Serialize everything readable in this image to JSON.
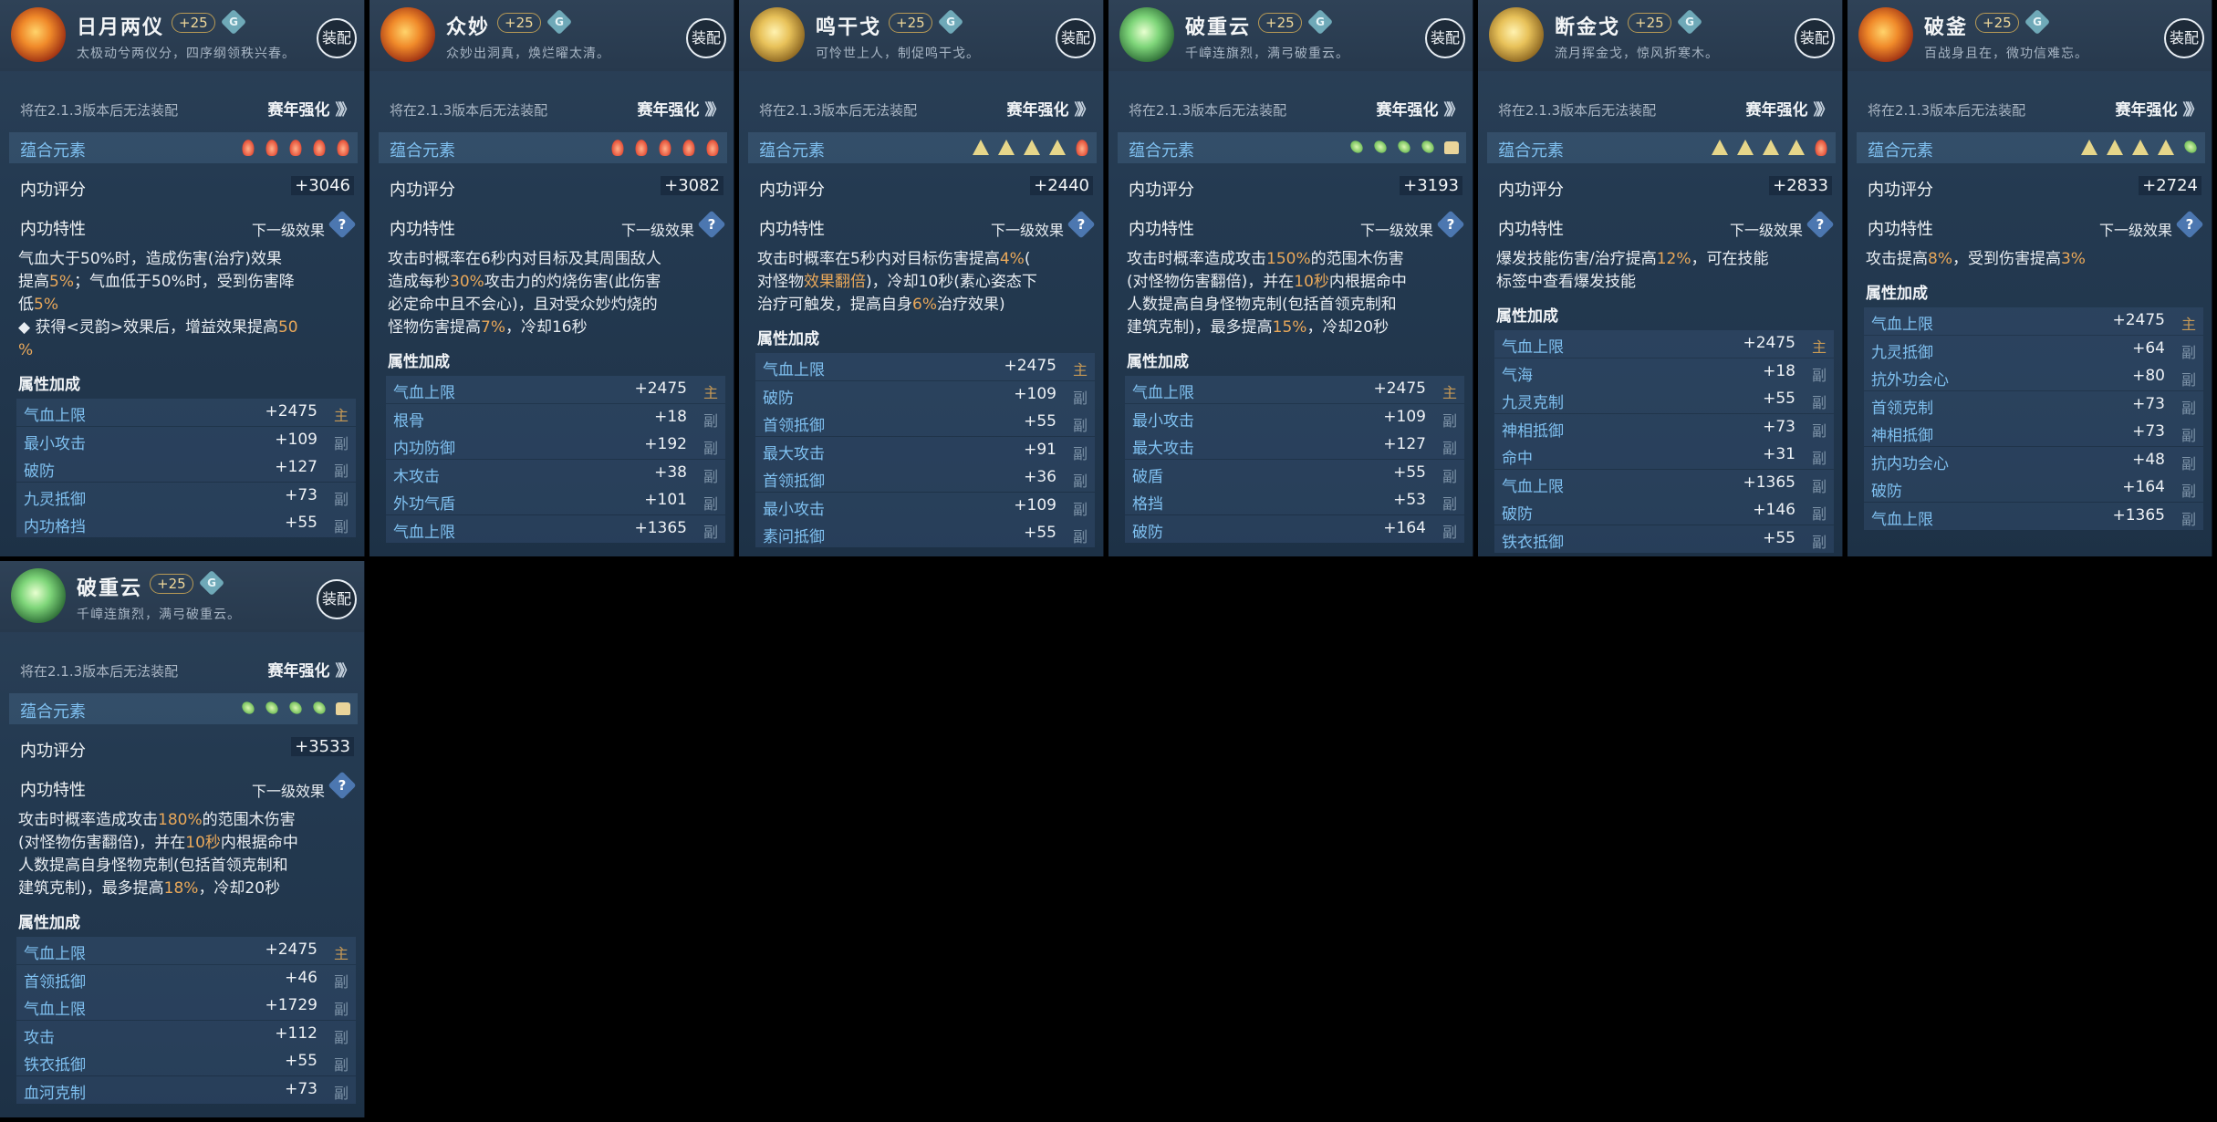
{
  "common": {
    "notice": "将在2.1.3版本后无法装配",
    "season": "赛年强化",
    "season_arrow": "》》",
    "equip": "装配",
    "element_label": "蕴合元素",
    "score_label": "内功评分",
    "trait_label": "内功特性",
    "next_label": "下一级效果",
    "q": "?",
    "attr_label": "属性加成",
    "g_badge": "G"
  },
  "cards": [
    {
      "name": "日月两仪",
      "plus": "+25",
      "emblem": "fire",
      "desc": "太极动兮两仪分，四序纲领秩兴春。",
      "gems": [
        "fire",
        "fire",
        "fire",
        "fire",
        "fire"
      ],
      "score": "+3046",
      "effect": [
        [
          {
            "t": "气血大于50%时，造成伤害(治疗)效果"
          }
        ],
        [
          {
            "t": "提高"
          },
          {
            "t": "5%",
            "h": 1
          },
          {
            "t": "；气血低于50%时，受到伤害降"
          }
        ],
        [
          {
            "t": "低"
          },
          {
            "t": "5%",
            "h": 1
          }
        ],
        [
          {
            "t": " ◆ 获得<灵韵>效果后，增益效果提高"
          },
          {
            "t": "50",
            "h": 1
          }
        ],
        [
          {
            "t": "%",
            "h": 1
          }
        ]
      ],
      "attrs": [
        {
          "n": "气血上限",
          "v": "+2475",
          "b": "主"
        },
        {
          "n": "最小攻击",
          "v": "+109",
          "b": "副"
        },
        {
          "n": "破防",
          "v": "+127",
          "b": "副"
        },
        {
          "n": "九灵抵御",
          "v": "+73",
          "b": "副"
        },
        {
          "n": "内功格挡",
          "v": "+55",
          "b": "副"
        }
      ]
    },
    {
      "name": "众妙",
      "plus": "+25",
      "emblem": "fire",
      "desc": "众妙出洞真，焕烂曜太清。",
      "gems": [
        "fire",
        "fire",
        "fire",
        "fire",
        "fire"
      ],
      "score": "+3082",
      "effect": [
        [
          {
            "t": "攻击时概率在6秒内对目标及其周围敌人"
          }
        ],
        [
          {
            "t": "造成每秒"
          },
          {
            "t": "30%",
            "h": 1
          },
          {
            "t": "攻击力的灼烧伤害(此伤害"
          }
        ],
        [
          {
            "t": "必定命中且不会心)，且对受众妙灼烧的"
          }
        ],
        [
          {
            "t": "怪物伤害提高"
          },
          {
            "t": "7%",
            "h": 1
          },
          {
            "t": "，冷却16秒"
          }
        ]
      ],
      "attrs": [
        {
          "n": "气血上限",
          "v": "+2475",
          "b": "主"
        },
        {
          "n": "根骨",
          "v": "+18",
          "b": "副"
        },
        {
          "n": "内功防御",
          "v": "+192",
          "b": "副"
        },
        {
          "n": "木攻击",
          "v": "+38",
          "b": "副"
        },
        {
          "n": "外功气盾",
          "v": "+101",
          "b": "副"
        },
        {
          "n": "气血上限",
          "v": "+1365",
          "b": "副"
        }
      ]
    },
    {
      "name": "鸣干戈",
      "plus": "+25",
      "emblem": "gold",
      "desc": "可怜世上人，制促鸣干戈。",
      "gems": [
        "metal",
        "metal",
        "metal",
        "metal",
        "fire"
      ],
      "score": "+2440",
      "effect": [
        [
          {
            "t": "攻击时概率在5秒内对目标伤害提高"
          },
          {
            "t": "4%",
            "h": 1
          },
          {
            "t": "("
          }
        ],
        [
          {
            "t": "对怪物"
          },
          {
            "t": "效果翻倍",
            "h": 1
          },
          {
            "t": ")，冷却10秒(素心姿态下"
          }
        ],
        [
          {
            "t": "治疗可触发，提高自身"
          },
          {
            "t": "6%",
            "h": 1
          },
          {
            "t": "治疗效果)"
          }
        ]
      ],
      "attrs": [
        {
          "n": "气血上限",
          "v": "+2475",
          "b": "主"
        },
        {
          "n": "破防",
          "v": "+109",
          "b": "副"
        },
        {
          "n": "首领抵御",
          "v": "+55",
          "b": "副"
        },
        {
          "n": "最大攻击",
          "v": "+91",
          "b": "副"
        },
        {
          "n": "首领抵御",
          "v": "+36",
          "b": "副"
        },
        {
          "n": "最小攻击",
          "v": "+109",
          "b": "副"
        },
        {
          "n": "素问抵御",
          "v": "+55",
          "b": "副"
        }
      ]
    },
    {
      "name": "破重云",
      "plus": "+25",
      "emblem": "green",
      "desc": "千嶂连旗烈，满弓破重云。",
      "gems": [
        "wood",
        "wood",
        "wood",
        "wood",
        "earth"
      ],
      "score": "+3193",
      "effect": [
        [
          {
            "t": "攻击时概率造成攻击"
          },
          {
            "t": "150%",
            "h": 1
          },
          {
            "t": "的范围木伤害"
          }
        ],
        [
          {
            "t": "(对怪物伤害翻倍)，并在"
          },
          {
            "t": "10秒",
            "h": 1
          },
          {
            "t": "内根据命中"
          }
        ],
        [
          {
            "t": "人数提高自身怪物克制(包括首领克制和"
          }
        ],
        [
          {
            "t": "建筑克制)，最多提高"
          },
          {
            "t": "15%",
            "h": 1
          },
          {
            "t": "，冷却20秒"
          }
        ]
      ],
      "attrs": [
        {
          "n": "气血上限",
          "v": "+2475",
          "b": "主"
        },
        {
          "n": "最小攻击",
          "v": "+109",
          "b": "副"
        },
        {
          "n": "最大攻击",
          "v": "+127",
          "b": "副"
        },
        {
          "n": "破盾",
          "v": "+55",
          "b": "副"
        },
        {
          "n": "格挡",
          "v": "+53",
          "b": "副"
        },
        {
          "n": "破防",
          "v": "+164",
          "b": "副"
        }
      ]
    },
    {
      "name": "断金戈",
      "plus": "+25",
      "emblem": "gold",
      "desc": "流月挥金戈，惊风折寒木。",
      "gems": [
        "metal",
        "metal",
        "metal",
        "metal",
        "fire"
      ],
      "score": "+2833",
      "effect": [
        [
          {
            "t": "爆发技能伤害/治疗提高"
          },
          {
            "t": "12%",
            "h": 1
          },
          {
            "t": "，可在技能"
          }
        ],
        [
          {
            "t": "标签中查看爆发技能"
          }
        ]
      ],
      "attrs": [
        {
          "n": "气血上限",
          "v": "+2475",
          "b": "主"
        },
        {
          "n": "气海",
          "v": "+18",
          "b": "副"
        },
        {
          "n": "九灵克制",
          "v": "+55",
          "b": "副"
        },
        {
          "n": "神相抵御",
          "v": "+73",
          "b": "副"
        },
        {
          "n": "命中",
          "v": "+31",
          "b": "副"
        },
        {
          "n": "气血上限",
          "v": "+1365",
          "b": "副"
        },
        {
          "n": "破防",
          "v": "+146",
          "b": "副"
        },
        {
          "n": "铁衣抵御",
          "v": "+55",
          "b": "副"
        }
      ]
    },
    {
      "name": "破釜",
      "plus": "+25",
      "emblem": "fire",
      "desc": "百战身且在，微功信难忘。",
      "gems": [
        "metal",
        "metal",
        "metal",
        "metal",
        "wood"
      ],
      "score": "+2724",
      "effect": [
        [
          {
            "t": "攻击提高"
          },
          {
            "t": "8%",
            "h": 1
          },
          {
            "t": "，受到伤害提高"
          },
          {
            "t": "3%",
            "h": 1
          }
        ]
      ],
      "attrs": [
        {
          "n": "气血上限",
          "v": "+2475",
          "b": "主"
        },
        {
          "n": "九灵抵御",
          "v": "+64",
          "b": "副"
        },
        {
          "n": "抗外功会心",
          "v": "+80",
          "b": "副"
        },
        {
          "n": "首领克制",
          "v": "+73",
          "b": "副"
        },
        {
          "n": "神相抵御",
          "v": "+73",
          "b": "副"
        },
        {
          "n": "抗内功会心",
          "v": "+48",
          "b": "副"
        },
        {
          "n": "破防",
          "v": "+164",
          "b": "副"
        },
        {
          "n": "气血上限",
          "v": "+1365",
          "b": "副"
        }
      ]
    },
    {
      "name": "破重云",
      "plus": "+25",
      "emblem": "green",
      "desc": "千嶂连旗烈，满弓破重云。",
      "gems": [
        "wood",
        "wood",
        "wood",
        "wood",
        "earth"
      ],
      "score": "+3533",
      "effect": [
        [
          {
            "t": "攻击时概率造成攻击"
          },
          {
            "t": "180%",
            "h": 1
          },
          {
            "t": "的范围木伤害"
          }
        ],
        [
          {
            "t": "(对怪物伤害翻倍)，并在"
          },
          {
            "t": "10秒",
            "h": 1
          },
          {
            "t": "内根据命中"
          }
        ],
        [
          {
            "t": "人数提高自身怪物克制(包括首领克制和"
          }
        ],
        [
          {
            "t": "建筑克制)，最多提高"
          },
          {
            "t": "18%",
            "h": 1
          },
          {
            "t": "，冷却20秒"
          }
        ]
      ],
      "attrs": [
        {
          "n": "气血上限",
          "v": "+2475",
          "b": "主"
        },
        {
          "n": "首领抵御",
          "v": "+46",
          "b": "副"
        },
        {
          "n": "气血上限",
          "v": "+1729",
          "b": "副"
        },
        {
          "n": "攻击",
          "v": "+112",
          "b": "副"
        },
        {
          "n": "铁衣抵御",
          "v": "+55",
          "b": "副"
        },
        {
          "n": "血河克制",
          "v": "+73",
          "b": "副"
        }
      ]
    }
  ]
}
